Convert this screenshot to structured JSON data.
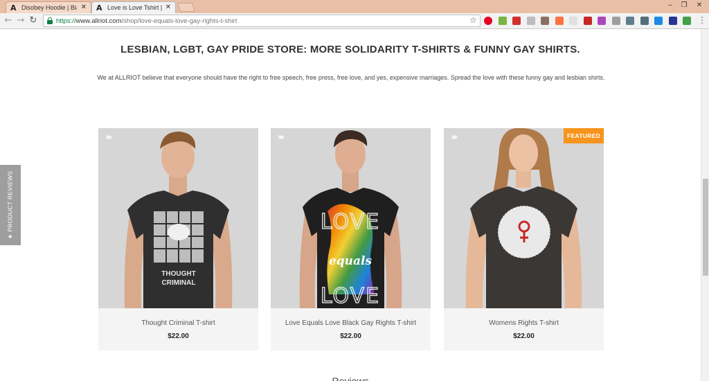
{
  "browser": {
    "tabs": [
      {
        "title": "Disobey Hoodie | Black D",
        "active": false
      },
      {
        "title": "Love is Love Tshirt | Func",
        "active": true
      }
    ],
    "url": {
      "scheme": "https://",
      "host": "www.allriot.com",
      "path": "/shop/love-equals-love-gay-rights-t-shirt"
    },
    "window_controls": [
      "–",
      "❐",
      "✕"
    ],
    "extensions": [
      {
        "name": "pinterest-icon",
        "color": "#e60023"
      },
      {
        "name": "extension-green-icon",
        "color": "#7cb342"
      },
      {
        "name": "extension-red-icon",
        "color": "#d32f2f"
      },
      {
        "name": "extension-gray-icon",
        "color": "#bdbdbd"
      },
      {
        "name": "extension-pen-icon",
        "color": "#8d6e63"
      },
      {
        "name": "extension-orange-icon",
        "color": "#ff7043"
      },
      {
        "name": "extension-light-icon",
        "color": "#e0e0e0"
      },
      {
        "name": "extension-marker-icon",
        "color": "#c62828"
      },
      {
        "name": "extension-flower-icon",
        "color": "#ab47bc"
      },
      {
        "name": "extension-box-icon",
        "color": "#9e9e9e"
      },
      {
        "name": "extension-moon-icon",
        "color": "#607d8b"
      },
      {
        "name": "search-extension-icon",
        "color": "#546e7a"
      },
      {
        "name": "extension-blue-icon",
        "color": "#1e88e5"
      },
      {
        "name": "extension-navy-icon",
        "color": "#283593"
      },
      {
        "name": "extension-refresh-icon",
        "color": "#43a047"
      }
    ]
  },
  "page": {
    "heading": "LESBIAN, LGBT, GAY PRIDE STORE: MORE SOLIDARITY T-SHIRTS & FUNNY GAY SHIRTS.",
    "intro": "We at ALLRIOT believe that everyone should have the right to free speech, free press, free love, and yes, expensive marriages. Spread the love with these funny gay and lesbian shirts.",
    "reviews_tab": "★ PRODUCT REVIEWS",
    "products": [
      {
        "name": "Thought Criminal T-shirt",
        "price": "$22.00",
        "featured": false,
        "print_text": "THOUGHT CRIMINAL"
      },
      {
        "name": "Love Equals Love Black Gay Rights T-shirt",
        "price": "$22.00",
        "featured": false,
        "print_text": "LOVE equals LOVE"
      },
      {
        "name": "Womens Rights T-shirt",
        "price": "$22.00",
        "featured": true,
        "badge": "FEATURED"
      }
    ],
    "bottom_heading": "Reviews"
  },
  "colors": {
    "tabbar": "#e9bfa7",
    "badge": "#f7941d",
    "secure": "#0b8043"
  }
}
